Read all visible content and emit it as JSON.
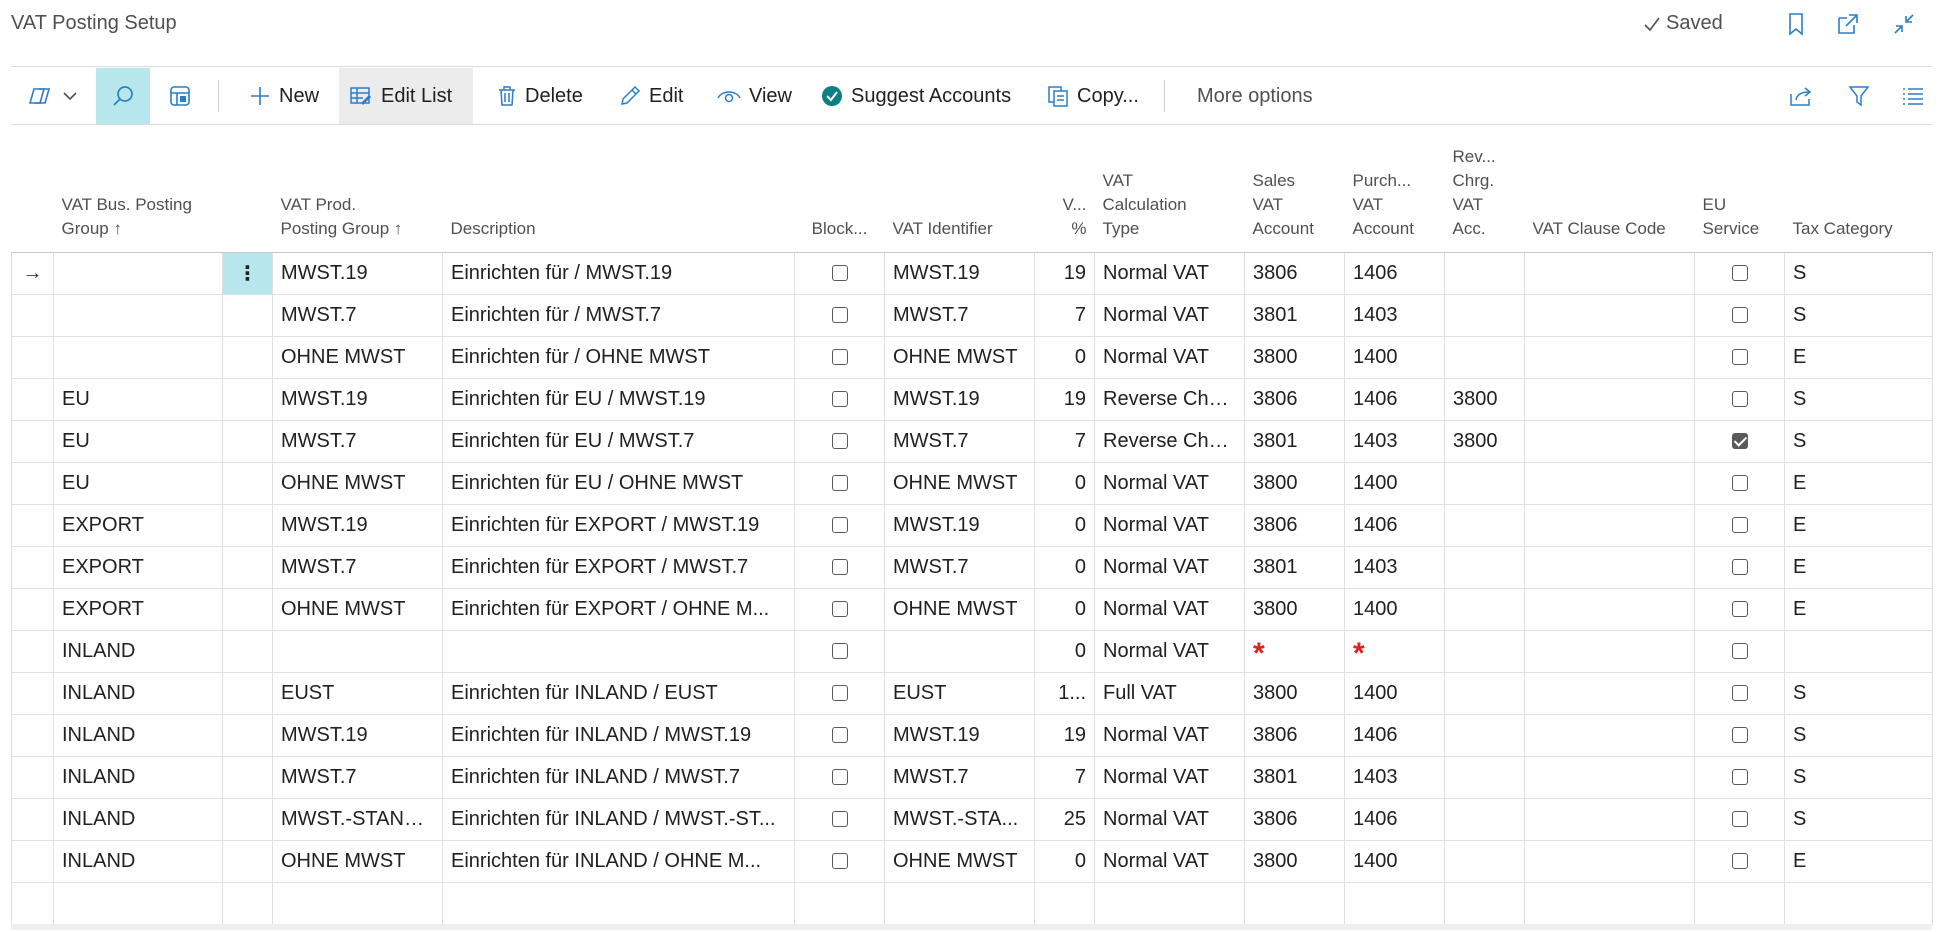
{
  "header": {
    "title": "VAT Posting Setup",
    "saved_label": "Saved"
  },
  "toolbar": {
    "new_label": "New",
    "edit_list_label": "Edit List",
    "delete_label": "Delete",
    "edit_label": "Edit",
    "view_label": "View",
    "suggest_accounts_label": "Suggest Accounts",
    "copy_label": "Copy...",
    "more_options_label": "More options"
  },
  "columns": {
    "bus_group_1": "VAT Bus. Posting",
    "bus_group_2": "Group ↑",
    "prod_group_1": "VAT Prod.",
    "prod_group_2": "Posting Group ↑",
    "description": "Description",
    "blocked": "Block...",
    "vat_identifier": "VAT Identifier",
    "vat_pct_1": "V...",
    "vat_pct_2": "%",
    "calc_type_1": "VAT",
    "calc_type_2": "Calculation",
    "calc_type_3": "Type",
    "sales_acc_1": "Sales",
    "sales_acc_2": "VAT",
    "sales_acc_3": "Account",
    "purch_acc_1": "Purch...",
    "purch_acc_2": "VAT",
    "purch_acc_3": "Account",
    "rev_chrg_1": "Rev...",
    "rev_chrg_2": "Chrg.",
    "rev_chrg_3": "VAT",
    "rev_chrg_4": "Acc.",
    "clause_code": "VAT Clause Code",
    "eu_service_1": "EU",
    "eu_service_2": "Service",
    "tax_category": "Tax Category"
  },
  "rows": [
    {
      "bus": "",
      "prod": "MWST.19",
      "desc": "Einrichten für  / MWST.19",
      "blocked": false,
      "ident": "MWST.19",
      "pct": "19",
      "calc": "Normal VAT",
      "sales": "3806",
      "purch": "1406",
      "rev": "",
      "clause": "",
      "eu": false,
      "tax": "S"
    },
    {
      "bus": "",
      "prod": "MWST.7",
      "desc": "Einrichten für  / MWST.7",
      "blocked": false,
      "ident": "MWST.7",
      "pct": "7",
      "calc": "Normal VAT",
      "sales": "3801",
      "purch": "1403",
      "rev": "",
      "clause": "",
      "eu": false,
      "tax": "S"
    },
    {
      "bus": "",
      "prod": "OHNE MWST",
      "desc": "Einrichten für  / OHNE MWST",
      "blocked": false,
      "ident": "OHNE MWST",
      "pct": "0",
      "calc": "Normal VAT",
      "sales": "3800",
      "purch": "1400",
      "rev": "",
      "clause": "",
      "eu": false,
      "tax": "E"
    },
    {
      "bus": "EU",
      "prod": "MWST.19",
      "desc": "Einrichten für EU / MWST.19",
      "blocked": false,
      "ident": "MWST.19",
      "pct": "19",
      "calc": "Reverse Char...",
      "sales": "3806",
      "purch": "1406",
      "rev": "3800",
      "clause": "",
      "eu": false,
      "tax": "S"
    },
    {
      "bus": "EU",
      "prod": "MWST.7",
      "desc": "Einrichten für EU / MWST.7",
      "blocked": false,
      "ident": "MWST.7",
      "pct": "7",
      "calc": "Reverse Char...",
      "sales": "3801",
      "purch": "1403",
      "rev": "3800",
      "clause": "",
      "eu": true,
      "tax": "S"
    },
    {
      "bus": "EU",
      "prod": "OHNE MWST",
      "desc": "Einrichten für EU / OHNE MWST",
      "blocked": false,
      "ident": "OHNE MWST",
      "pct": "0",
      "calc": "Normal VAT",
      "sales": "3800",
      "purch": "1400",
      "rev": "",
      "clause": "",
      "eu": false,
      "tax": "E"
    },
    {
      "bus": "EXPORT",
      "prod": "MWST.19",
      "desc": "Einrichten für EXPORT / MWST.19",
      "blocked": false,
      "ident": "MWST.19",
      "pct": "0",
      "calc": "Normal VAT",
      "sales": "3806",
      "purch": "1406",
      "rev": "",
      "clause": "",
      "eu": false,
      "tax": "E"
    },
    {
      "bus": "EXPORT",
      "prod": "MWST.7",
      "desc": "Einrichten für EXPORT / MWST.7",
      "blocked": false,
      "ident": "MWST.7",
      "pct": "0",
      "calc": "Normal VAT",
      "sales": "3801",
      "purch": "1403",
      "rev": "",
      "clause": "",
      "eu": false,
      "tax": "E"
    },
    {
      "bus": "EXPORT",
      "prod": "OHNE MWST",
      "desc": "Einrichten für EXPORT / OHNE M...",
      "blocked": false,
      "ident": "OHNE MWST",
      "pct": "0",
      "calc": "Normal VAT",
      "sales": "3800",
      "purch": "1400",
      "rev": "",
      "clause": "",
      "eu": false,
      "tax": "E"
    },
    {
      "bus": "INLAND",
      "prod": "",
      "desc": "",
      "blocked": false,
      "ident": "",
      "pct": "0",
      "calc": "Normal VAT",
      "sales": "*",
      "purch": "*",
      "rev": "",
      "clause": "",
      "eu": false,
      "tax": "",
      "required": true
    },
    {
      "bus": "INLAND",
      "prod": "EUST",
      "desc": "Einrichten für INLAND / EUST",
      "blocked": false,
      "ident": "EUST",
      "pct": "1...",
      "calc": "Full VAT",
      "sales": "3800",
      "purch": "1400",
      "rev": "",
      "clause": "",
      "eu": false,
      "tax": "S"
    },
    {
      "bus": "INLAND",
      "prod": "MWST.19",
      "desc": "Einrichten für INLAND / MWST.19",
      "blocked": false,
      "ident": "MWST.19",
      "pct": "19",
      "calc": "Normal VAT",
      "sales": "3806",
      "purch": "1406",
      "rev": "",
      "clause": "",
      "eu": false,
      "tax": "S"
    },
    {
      "bus": "INLAND",
      "prod": "MWST.7",
      "desc": "Einrichten für INLAND / MWST.7",
      "blocked": false,
      "ident": "MWST.7",
      "pct": "7",
      "calc": "Normal VAT",
      "sales": "3801",
      "purch": "1403",
      "rev": "",
      "clause": "",
      "eu": false,
      "tax": "S"
    },
    {
      "bus": "INLAND",
      "prod": "MWST.-STAND...",
      "desc": "Einrichten für INLAND / MWST.-ST...",
      "blocked": false,
      "ident": "MWST.-STA...",
      "pct": "25",
      "calc": "Normal VAT",
      "sales": "3806",
      "purch": "1406",
      "rev": "",
      "clause": "",
      "eu": false,
      "tax": "S"
    },
    {
      "bus": "INLAND",
      "prod": "OHNE MWST",
      "desc": "Einrichten für INLAND / OHNE M...",
      "blocked": false,
      "ident": "OHNE MWST",
      "pct": "0",
      "calc": "Normal VAT",
      "sales": "3800",
      "purch": "1400",
      "rev": "",
      "clause": "",
      "eu": false,
      "tax": "E"
    }
  ],
  "colors": {
    "accent": "#b7e7ec",
    "suggest_icon": "#0a7f86",
    "required": "#e02020"
  }
}
